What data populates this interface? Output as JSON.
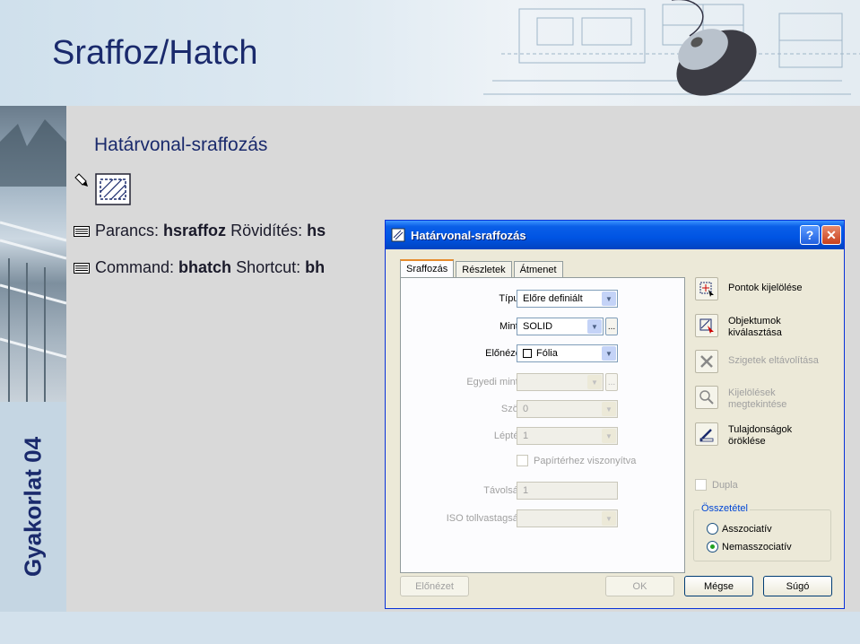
{
  "slide": {
    "title": "Sraffoz/Hatch",
    "side_label": "Gyakorlat 04",
    "section_title": "Határvonal-sraffozás"
  },
  "commands": [
    {
      "label": "Parancs: ",
      "command": "hsraffoz",
      "shortcut_label": " Rövidítés: ",
      "shortcut": "hs"
    },
    {
      "label": "Command: ",
      "command": "bhatch",
      "shortcut_label": " Shortcut: ",
      "shortcut": "bh"
    }
  ],
  "icons": {
    "tool": "hatch-tool-icon",
    "keyboard": "keyboard-icon",
    "pencil": "pencil-icon"
  },
  "dialog": {
    "title": "Határvonal-sraffozás",
    "help_glyph": "?",
    "close_glyph": "✕",
    "tabs": [
      {
        "label": "Sraffozás",
        "active": true
      },
      {
        "label": "Részletek",
        "active": false
      },
      {
        "label": "Átmenet",
        "active": false
      }
    ],
    "fields": {
      "tipus": {
        "label": "Típus:",
        "value": "Előre definiált"
      },
      "minta": {
        "label": "Minta:",
        "value": "SOLID",
        "more": "..."
      },
      "elonezet": {
        "label": "Előnézet:",
        "value": "Fólia"
      },
      "egyedi_minta": {
        "label": "Egyedi minta:",
        "value": "",
        "more": "..."
      },
      "szog": {
        "label": "Szög:",
        "value": "0"
      },
      "leptek": {
        "label": "Lépték:",
        "value": "1"
      },
      "papirterhez": {
        "label": "Papírtérhez viszonyítva"
      },
      "tavolsag": {
        "label": "Távolság:",
        "value": "1"
      },
      "iso": {
        "label": "ISO tollvastagság:",
        "value": ""
      }
    },
    "side_actions": [
      {
        "line1": "Pontok kijelölése",
        "line2": "",
        "enabled": true
      },
      {
        "line1": "Objektumok",
        "line2": "kiválasztása",
        "enabled": true
      },
      {
        "line1": "Szigetek eltávolítása",
        "line2": "",
        "enabled": false
      },
      {
        "line1": "Kijelölések",
        "line2": "megtekintése",
        "enabled": false
      },
      {
        "line1": "Tulajdonságok",
        "line2": "öröklése",
        "enabled": true
      }
    ],
    "dupla": {
      "label": "Dupla",
      "checked": false
    },
    "osszetetel": {
      "legend": "Összetétel",
      "options": [
        {
          "label": "Asszociatív",
          "selected": false
        },
        {
          "label": "Nemasszociatív",
          "selected": true
        }
      ]
    },
    "buttons": {
      "preview": "Előnézet",
      "ok": "OK",
      "cancel": "Mégse",
      "help": "Súgó"
    }
  },
  "colors": {
    "title_blue": "#1a2a6c",
    "xp_title": "#0054e3",
    "dialog_bg": "#ece9d8"
  }
}
